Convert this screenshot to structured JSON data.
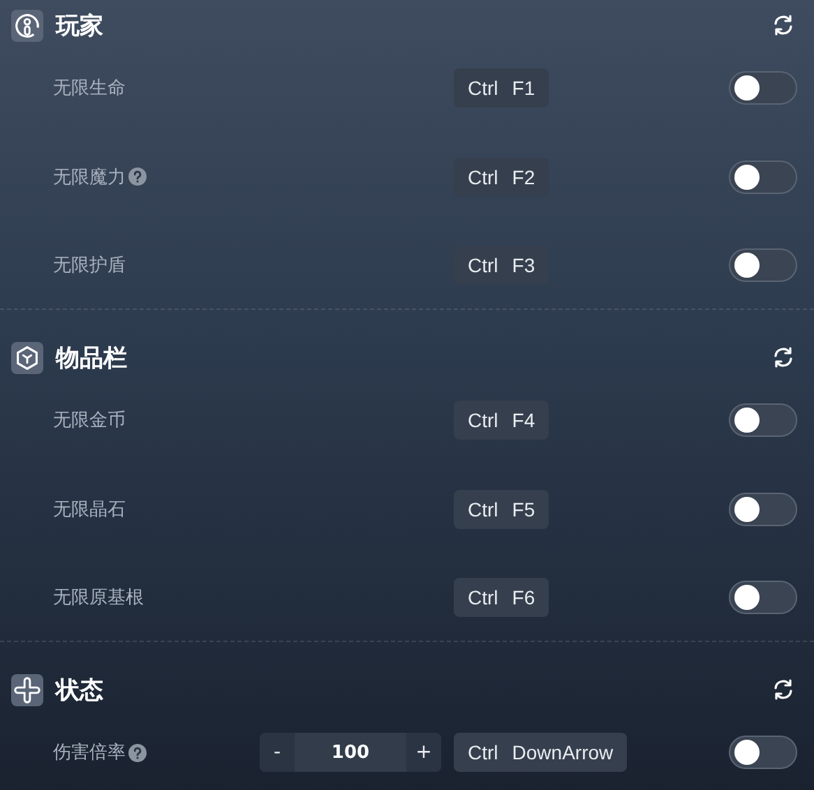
{
  "sections": [
    {
      "title": "玩家",
      "rows": [
        {
          "label": "无限生命",
          "help": false,
          "keys": [
            "Ctrl",
            "F1"
          ],
          "on": false
        },
        {
          "label": "无限魔力",
          "help": true,
          "keys": [
            "Ctrl",
            "F2"
          ],
          "on": false
        },
        {
          "label": "无限护盾",
          "help": false,
          "keys": [
            "Ctrl",
            "F3"
          ],
          "on": false
        }
      ]
    },
    {
      "title": "物品栏",
      "rows": [
        {
          "label": "无限金币",
          "help": false,
          "keys": [
            "Ctrl",
            "F4"
          ],
          "on": false
        },
        {
          "label": "无限晶石",
          "help": false,
          "keys": [
            "Ctrl",
            "F5"
          ],
          "on": false
        },
        {
          "label": "无限原基根",
          "help": false,
          "keys": [
            "Ctrl",
            "F6"
          ],
          "on": false
        }
      ]
    },
    {
      "title": "状态",
      "rows": [
        {
          "label": "伤害倍率",
          "help": true,
          "stepper": {
            "minus": "-",
            "value": "100",
            "plus": "+"
          },
          "keys": [
            "Ctrl",
            "DownArrow"
          ],
          "on": false
        }
      ]
    }
  ]
}
